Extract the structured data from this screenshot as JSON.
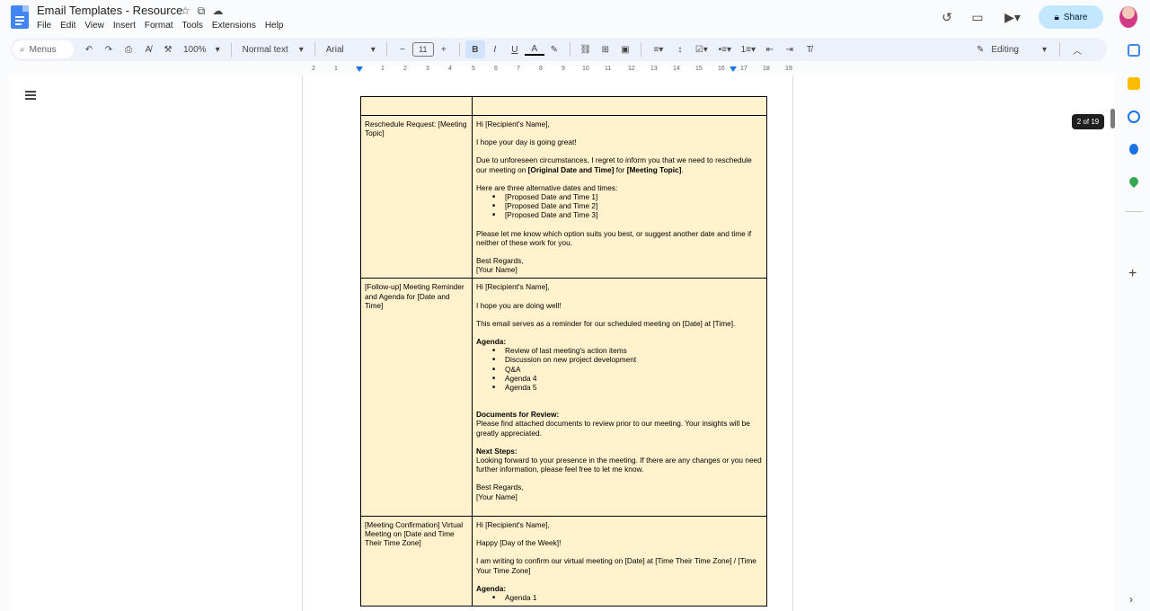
{
  "app": {
    "doc_title": "Email Templates - Resource",
    "menu": [
      "File",
      "Edit",
      "View",
      "Insert",
      "Format",
      "Tools",
      "Extensions",
      "Help"
    ],
    "share_label": "Share",
    "editing_label": "Editing"
  },
  "toolbar": {
    "menus_label": "Menus",
    "zoom": "100%",
    "style": "Normal text",
    "font": "Arial",
    "font_size": "11",
    "bold": "B",
    "italic": "I",
    "underline": "U",
    "text_color": "A"
  },
  "ruler": [
    "2",
    "1",
    "1",
    "2",
    "3",
    "4",
    "5",
    "6",
    "7",
    "8",
    "9",
    "10",
    "11",
    "12",
    "13",
    "14",
    "15",
    "16",
    "17",
    "18",
    "19"
  ],
  "page_badge": "2 of 19",
  "table": {
    "rows": [
      {
        "label": "",
        "paragraphs": []
      },
      {
        "label": "Reschedule Request: [Meeting Topic]",
        "greeting": "Hi [Recipient's Name],",
        "p1": "I hope your day is going great!",
        "p2_a": "Due to unforeseen circumstances, I regret to inform you that we need to reschedule our meeting on ",
        "p2_b": "[Original Date and Time]",
        "p2_c": " for ",
        "p2_d": "[Meeting Topic]",
        "p2_e": ".",
        "p3": "Here are three alternative dates and times:",
        "options": [
          "[Proposed Date and Time 1]",
          "[Proposed Date and Time 2]",
          "[Proposed Date and Time 3]"
        ],
        "p4": "Please let me know which option suits you best, or suggest another date and time if neither of these work for you.",
        "signoff": "Best Regards,",
        "name": "[Your Name]"
      },
      {
        "label": "[Follow-up] Meeting Reminder and Agenda for [Date and Time]",
        "greeting": "Hi [Recipient's Name],",
        "p1": "I hope you are doing well!",
        "p2": "This email serves as a reminder for our scheduled meeting on [Date] at [Time].",
        "agenda_heading": "Agenda:",
        "agenda": [
          "Review of last meeting's action items",
          "Discussion on new project development",
          "Q&A",
          "Agenda 4",
          "Agenda 5"
        ],
        "docs_heading": "Documents for Review:",
        "docs_text": "Please find attached documents to review prior to our meeting. Your insights will be greatly appreciated.",
        "next_heading": "Next Steps:",
        "next_text": "Looking forward to your presence in the meeting. If there are any changes or you need further information, please feel free to let me know.",
        "signoff": "Best Regards,",
        "name": "[Your Name]"
      },
      {
        "label": "[Meeting Confirmation] Virtual Meeting on [Date and Time Their Time Zone]",
        "greeting": "Hi [Recipient's Name],",
        "p1": "Happy [Day of the Week]!",
        "p2": "I am writing to confirm our virtual meeting on [Date] at [Time Their Time Zone] / [Time Your Time Zone]",
        "agenda_heading": "Agenda:",
        "agenda": [
          "Agenda 1"
        ]
      }
    ]
  },
  "colors": {
    "cell_bg": "#fff2cc",
    "share_bg": "#c2e7ff",
    "toolbar_bg": "#edf2fa",
    "doc_blue": "#4285f4"
  }
}
